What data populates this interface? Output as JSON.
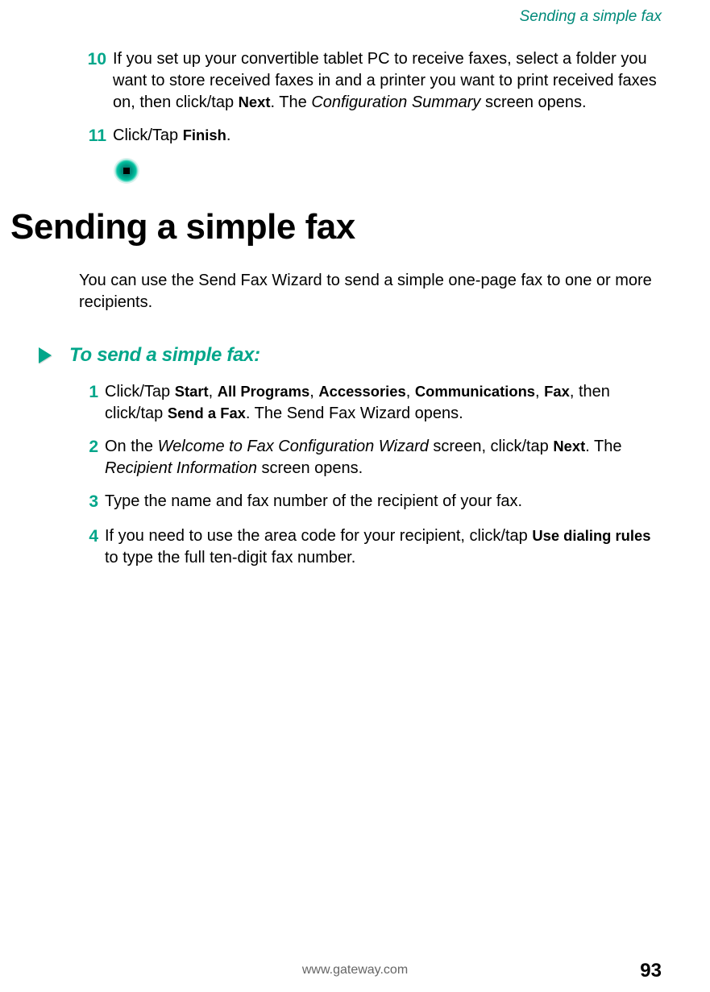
{
  "running_head": "Sending a simple fax",
  "prev_steps": [
    {
      "num": "10",
      "runs": [
        {
          "t": "If you set up your convertible tablet PC to receive faxes, select a folder you want to store received faxes in and a printer you want to print received faxes on, then click/tap "
        },
        {
          "t": "Next",
          "cls": "bold"
        },
        {
          "t": ". The "
        },
        {
          "t": "Configuration Summary",
          "cls": "ital"
        },
        {
          "t": " screen opens."
        }
      ]
    },
    {
      "num": "11",
      "runs": [
        {
          "t": "Click/Tap "
        },
        {
          "t": "Finish",
          "cls": "bold"
        },
        {
          "t": "."
        }
      ]
    }
  ],
  "h1": "Sending a simple fax",
  "intro": "You can use the Send Fax Wizard to send a simple one-page fax to one or more recipients.",
  "subhead": "To send a simple fax:",
  "steps": [
    {
      "num": "1",
      "runs": [
        {
          "t": "Click/Tap "
        },
        {
          "t": "Start",
          "cls": "bold"
        },
        {
          "t": ", "
        },
        {
          "t": "All Programs",
          "cls": "bold"
        },
        {
          "t": ", "
        },
        {
          "t": "Accessories",
          "cls": "bold"
        },
        {
          "t": ", "
        },
        {
          "t": "Communications",
          "cls": "bold"
        },
        {
          "t": ", "
        },
        {
          "t": "Fax",
          "cls": "bold"
        },
        {
          "t": ", then click/tap "
        },
        {
          "t": "Send a Fax",
          "cls": "bold"
        },
        {
          "t": ". The Send Fax Wizard opens."
        }
      ]
    },
    {
      "num": "2",
      "runs": [
        {
          "t": "On the "
        },
        {
          "t": "Welcome to Fax Configuration Wizard",
          "cls": "ital"
        },
        {
          "t": " screen, click/tap "
        },
        {
          "t": "Next",
          "cls": "bold"
        },
        {
          "t": ". The "
        },
        {
          "t": "Recipient Information",
          "cls": "ital"
        },
        {
          "t": " screen opens."
        }
      ]
    },
    {
      "num": "3",
      "runs": [
        {
          "t": "Type the name and fax number of the recipient of your fax."
        }
      ]
    },
    {
      "num": "4",
      "runs": [
        {
          "t": "If you need to use the area code for your recipient, click/tap "
        },
        {
          "t": "Use dialing rules",
          "cls": "bold"
        },
        {
          "t": " to type the full ten-digit fax number."
        }
      ]
    }
  ],
  "footer_url": "www.gateway.com",
  "page_number": "93"
}
